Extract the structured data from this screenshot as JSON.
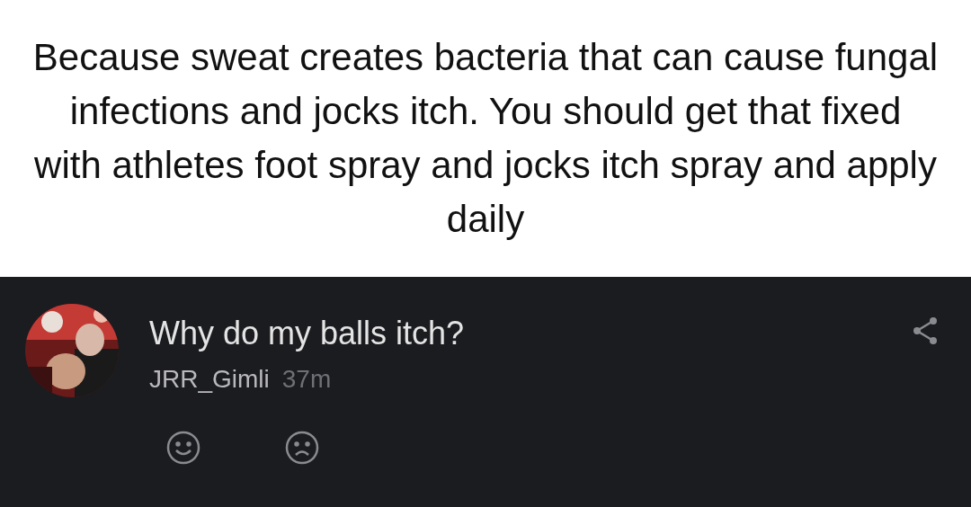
{
  "caption": "Because sweat creates bacteria that can cause fungal infections and jocks itch. You should get that fixed with athletes foot spray and jocks itch spray and apply daily",
  "post": {
    "title": "Why do my balls itch?",
    "author": "JRR_Gimli",
    "time": "37m"
  }
}
